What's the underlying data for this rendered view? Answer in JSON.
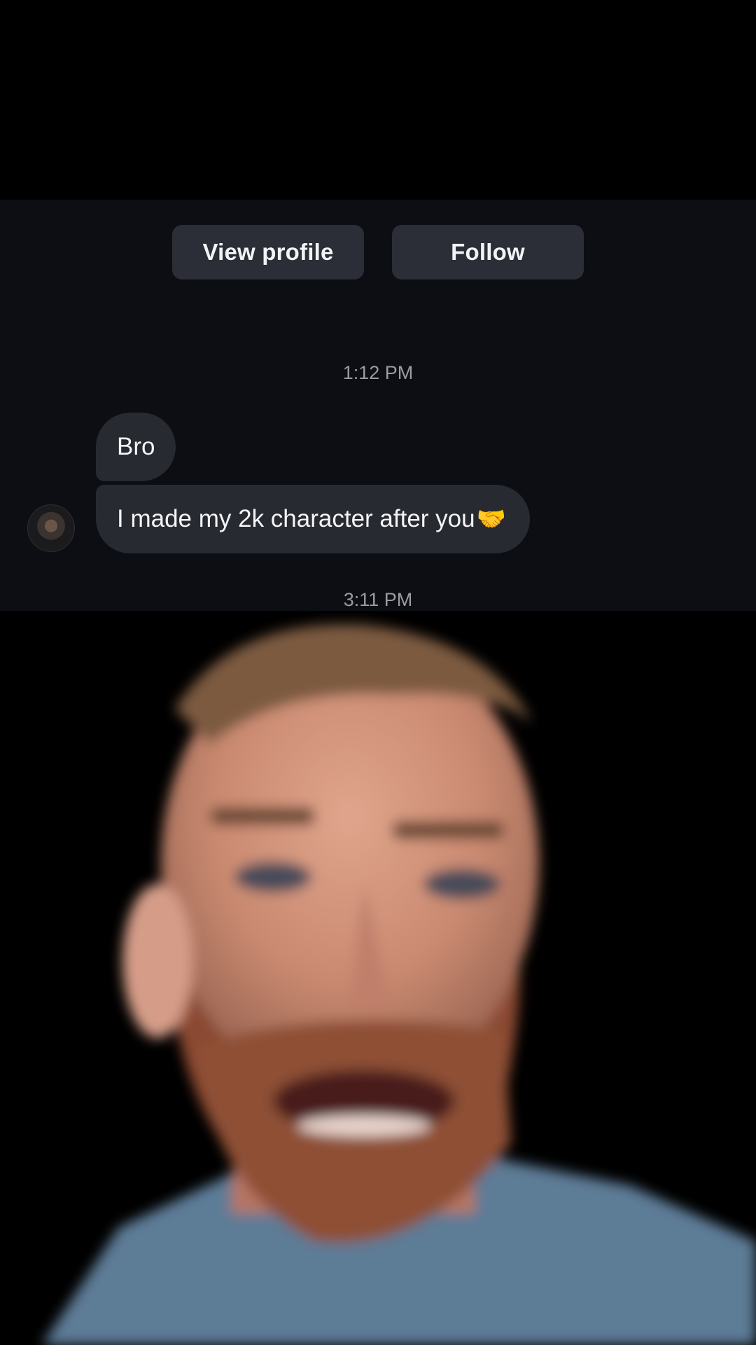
{
  "dm": {
    "actions": {
      "view_profile_label": "View profile",
      "follow_label": "Follow"
    },
    "timestamps": [
      "1:12 PM",
      "3:11 PM"
    ],
    "messages": [
      {
        "text": "Bro"
      },
      {
        "text": "I made my 2k character after you",
        "emoji": "🤝"
      }
    ]
  },
  "colors": {
    "panel_bg": "#0c0e13",
    "bubble_bg": "#272a31",
    "button_bg": "#2b2e36"
  }
}
